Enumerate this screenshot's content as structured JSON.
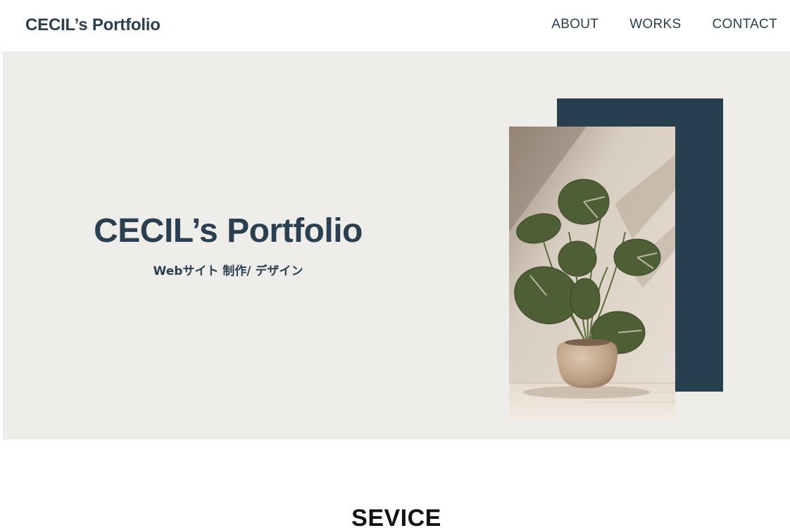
{
  "header": {
    "logo": "CECIL’s Portfolio",
    "nav": [
      "ABOUT",
      "WORKS",
      "CONTACT"
    ]
  },
  "hero": {
    "title": "CECIL’s Portfolio",
    "subtitle": "Webサイト 制作/ デザイン",
    "image": "potted-monstera-plant-photo"
  },
  "service": {
    "title": "SEVICE"
  },
  "colors": {
    "primary": "#2a3f50",
    "navy_block": "#283f4f",
    "hero_bg": "#efedea",
    "text_dark": "#111111"
  }
}
